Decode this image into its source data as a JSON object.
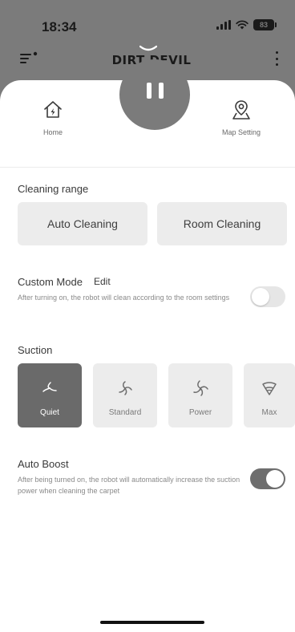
{
  "status_bar": {
    "time": "18:34",
    "battery": "83"
  },
  "header": {
    "brand": "DIRT DEVIL"
  },
  "shortcuts": {
    "home_label": "Home",
    "map_label": "Map Setting"
  },
  "cleaning_range": {
    "title": "Cleaning range",
    "options": [
      {
        "label": "Auto Cleaning"
      },
      {
        "label": "Room Cleaning"
      }
    ]
  },
  "custom_mode": {
    "title": "Custom Mode",
    "edit_label": "Edit",
    "description": "After turning on, the robot will clean according to the room settings",
    "enabled": false
  },
  "suction": {
    "title": "Suction",
    "selected": "Quiet",
    "levels": [
      {
        "label": "Quiet",
        "icon": "fan-quiet-icon"
      },
      {
        "label": "Standard",
        "icon": "fan-standard-icon"
      },
      {
        "label": "Power",
        "icon": "fan-power-icon"
      },
      {
        "label": "Max",
        "icon": "fan-max-icon"
      }
    ]
  },
  "auto_boost": {
    "title": "Auto Boost",
    "description": "After being turned on, the robot will automatically increase the suction power when cleaning the carpet",
    "enabled": true
  },
  "colors": {
    "header_bg": "#7b7b7b",
    "card_bg": "#ececec",
    "active_card_bg": "#6a6a6a",
    "toggle_on": "#6e6e6e"
  }
}
